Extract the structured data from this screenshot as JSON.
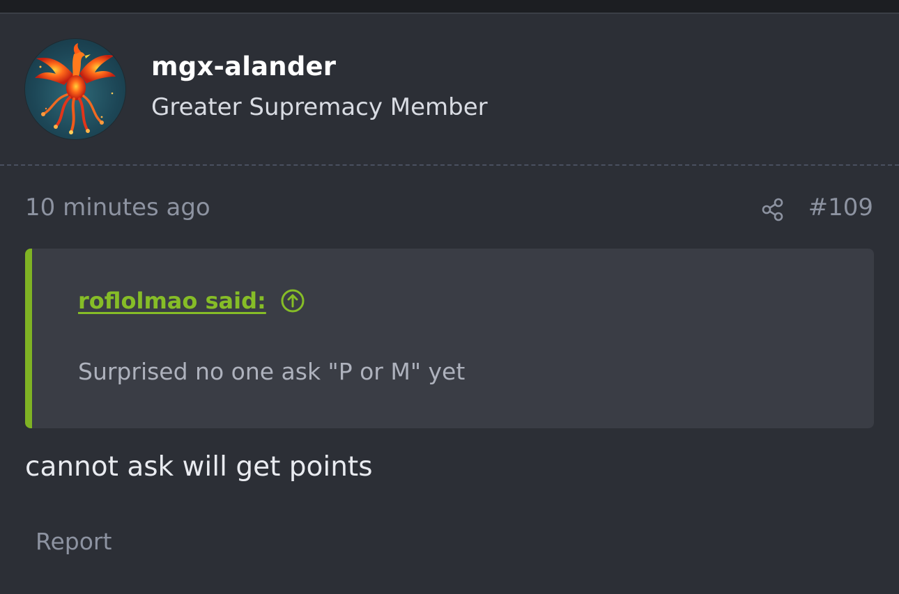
{
  "post": {
    "author": {
      "username": "mgx-alander",
      "title": "Greater Supremacy Member",
      "avatar_icon": "phoenix-avatar"
    },
    "timestamp": "10 minutes ago",
    "post_number": "#109",
    "share_icon": "share-icon",
    "quote": {
      "author_label": "roflolmao said:",
      "jump_icon": "arrow-up-circle-icon",
      "text": "Surprised no one ask \"P or M\" yet"
    },
    "message": "cannot ask will get points",
    "report_label": "Report"
  },
  "colors": {
    "background": "#2c2f36",
    "quote_background": "#3a3d45",
    "accent": "#86bd27",
    "muted_text": "#8d93a1"
  }
}
